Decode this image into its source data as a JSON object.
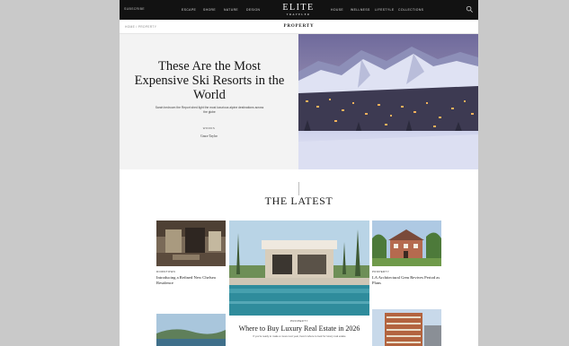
{
  "header": {
    "subscribe_text": "SUBSCRIBE",
    "logo_main": "ELITE",
    "logo_sub": "TRAVELER",
    "nav_left": [
      "ESCAPE",
      "SHORE",
      "NATURE",
      "DESIGN"
    ],
    "nav_right": [
      "HOUSE",
      "WELLNESS",
      "LIFESTYLE",
      "COLLECTIONS"
    ]
  },
  "subheader": {
    "breadcrumb": "HOME / PROPERTY",
    "section": "PROPERTY"
  },
  "hero": {
    "title": "These Are the Most Expensive Ski Resorts in the World",
    "dek": "Sarah bedroom the Report shed light the most luxurious alpine destinations across the globe",
    "words_label": "WORDS",
    "author": "Grace Taylor"
  },
  "latest": {
    "heading": "THE LATEST",
    "cards": [
      {
        "kicker": "DOWNTOWN",
        "title": "Introducing a Refined New Chelsea Residence"
      },
      {
        "kicker": "PROPERTY",
        "title": "LA Architectural Gem Revives Period as Plans"
      }
    ],
    "featured": {
      "kicker": "PROPERTY",
      "title": "Where to Buy Luxury Real Estate in 2026",
      "dek": "If you're ready to make a move next year, here's where to look for luxury real estate"
    }
  },
  "icons": {
    "search": "search-icon"
  },
  "colors": {
    "topbar": "#121212",
    "background": "#c9c9c9",
    "hero_panel": "#f3f3f3"
  }
}
